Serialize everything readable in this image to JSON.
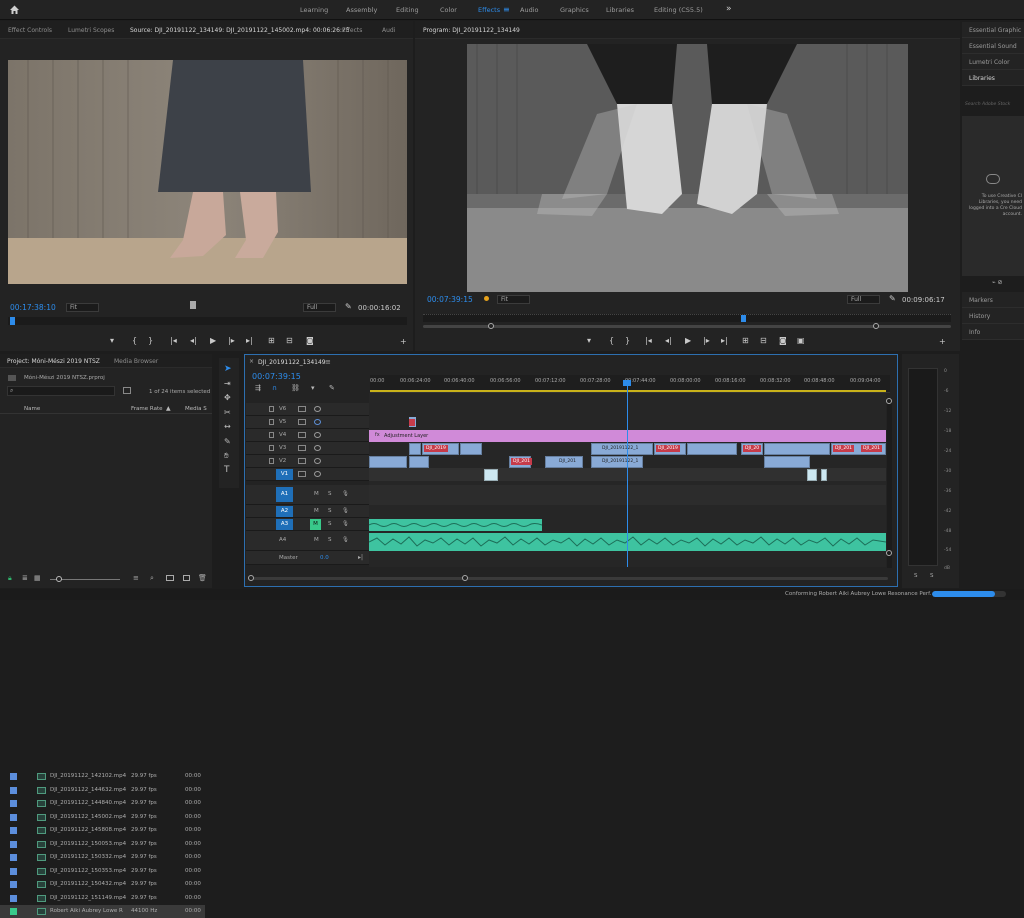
{
  "workspace_tabs": [
    "Learning",
    "Assembly",
    "Editing",
    "Color",
    "Effects",
    "Audio",
    "Graphics",
    "Libraries",
    "Editing (CS5.5)"
  ],
  "active_workspace": "Effects",
  "source_panel": {
    "tabs": [
      "Effect Controls",
      "Lumetri Scopes",
      "Source: DJI_20191122_134149: DJI_20191122_145002.mp4: 00:06:26:25",
      "Effects",
      "Audi"
    ],
    "timecode": "00:17:38:10",
    "fit_label": "Fit",
    "quality_label": "Full",
    "duration": "00:00:16:02"
  },
  "program_panel": {
    "tab": "Program: DJI_20191122_134149",
    "timecode": "00:07:39:15",
    "fit_label": "Fit",
    "quality_label": "Full",
    "duration": "00:09:06:17"
  },
  "right_panels": {
    "items": [
      "Essential Graphic",
      "Essential Sound",
      "Lumetri Color",
      "Libraries"
    ],
    "search_placeholder": "Search Adobe Stock",
    "cc_message": "To use Creative Cl Libraries, you need logged into a Cre Cloud account.",
    "lower_items": [
      "Markers",
      "History",
      "Info"
    ]
  },
  "project_panel": {
    "tabs": [
      "Project: Móni-Mészi 2019 NTSZ",
      "Media Browser"
    ],
    "project_file": "Móni-Mészi 2019 NTSZ.prproj",
    "selection_info": "1 of 24 items selected",
    "columns": [
      "Name",
      "Frame Rate",
      "Media S"
    ],
    "rows": [
      {
        "name": "DJI_20191122_142102.mp4",
        "rate": "29.97 fps",
        "media": "00:00"
      },
      {
        "name": "DJI_20191122_144632.mp4",
        "rate": "29.97 fps",
        "media": "00:00"
      },
      {
        "name": "DJI_20191122_144840.mp4",
        "rate": "29.97 fps",
        "media": "00:00"
      },
      {
        "name": "DJI_20191122_145002.mp4",
        "rate": "29.97 fps",
        "media": "00:00"
      },
      {
        "name": "DJI_20191122_145808.mp4",
        "rate": "29.97 fps",
        "media": "00:00"
      },
      {
        "name": "DJI_20191122_150053.mp4",
        "rate": "29.97 fps",
        "media": "00:00"
      },
      {
        "name": "DJI_20191122_150332.mp4",
        "rate": "29.97 fps",
        "media": "00:00"
      },
      {
        "name": "DJI_20191122_150353.mp4",
        "rate": "29.97 fps",
        "media": "00:00"
      },
      {
        "name": "DJI_20191122_150432.mp4",
        "rate": "29.97 fps",
        "media": "00:00"
      },
      {
        "name": "DJI_20191122_151149.mp4",
        "rate": "29.97 fps",
        "media": "00:00"
      },
      {
        "name": "Robert Aiki Aubrey Lowe R",
        "rate": "44100 Hz",
        "media": "00:00"
      }
    ]
  },
  "timeline": {
    "sequence_tab": "DJI_20191122_134149",
    "timecode": "00:07:39:15",
    "ruler": [
      "00:00",
      "00:06:24:00",
      "00:06:40:00",
      "00:06:56:00",
      "00:07:12:00",
      "00:07:28:00",
      "00:07:44:00",
      "00:08:00:00",
      "00:08:16:00",
      "00:08:32:00",
      "00:08:48:00",
      "00:09:04:00"
    ],
    "video_tracks": [
      "V6",
      "V5",
      "V4",
      "V3",
      "V2",
      "V1"
    ],
    "audio_tracks": [
      "A1",
      "A2",
      "A3",
      "A4"
    ],
    "source_patch_v": "V1",
    "source_patch_a": "A1",
    "master_label": "Master",
    "master_value": "0.0",
    "adjustment_layer_label": "Adjustment Layer",
    "clip_labels": {
      "v3_a": "DJI_20191122_1",
      "v2_a": "DJI_201",
      "v2_b": "DJI_20191122_1",
      "red1": "DJI_2019",
      "red2": "DJI_2019",
      "red3": "DJI_201",
      "red4": "DJI_20",
      "red5": "DJI_201",
      "red6": "DJI_201"
    }
  },
  "audio_meter": {
    "scale": [
      "0",
      "-6",
      "-12",
      "-18",
      "-24",
      "-30",
      "-36",
      "-42",
      "-48",
      "-54",
      "dB"
    ],
    "solo_labels": [
      "S",
      "S"
    ]
  },
  "status_bar": {
    "message": "Conforming Robert Aiki Aubrey Lowe Resonance Perf...",
    "progress": 0.85
  },
  "colors": {
    "accent": "#2d8ceb",
    "adjustment_layer": "#d08ad8",
    "video_clip": "#89aad6",
    "audio_clip": "#3ec3a0",
    "label_red": "#c63b4a",
    "track_selected": "#1f6fb8"
  }
}
